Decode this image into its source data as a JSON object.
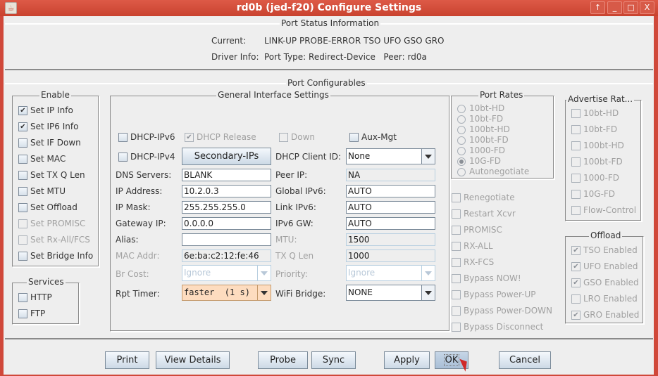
{
  "window": {
    "title": "rd0b  (jed-f20) Configure Settings",
    "buttons": {
      "pin": "↑",
      "minimize": "_",
      "maximize": "□",
      "close": "X"
    }
  },
  "status": {
    "title": "Port Status Information",
    "current_label": "Current:",
    "current_value": "LINK-UP PROBE-ERROR TSO UFO GSO GRO",
    "driver_label": "Driver Info:",
    "driver_value": "Port Type: Redirect-Device   Peer: rd0a"
  },
  "configurables": {
    "title": "Port Configurables",
    "enable": {
      "title": "Enable",
      "items": [
        {
          "label": "Set IP Info",
          "checked": true,
          "disabled": false
        },
        {
          "label": "Set IP6 Info",
          "checked": true,
          "disabled": false
        },
        {
          "label": "Set IF Down",
          "checked": false,
          "disabled": false
        },
        {
          "label": "Set MAC",
          "checked": false,
          "disabled": false
        },
        {
          "label": "Set TX Q Len",
          "checked": false,
          "disabled": false
        },
        {
          "label": "Set MTU",
          "checked": false,
          "disabled": false
        },
        {
          "label": "Set Offload",
          "checked": false,
          "disabled": false
        },
        {
          "label": "Set PROMISC",
          "checked": false,
          "disabled": true
        },
        {
          "label": "Set Rx-All/FCS",
          "checked": false,
          "disabled": true
        },
        {
          "label": "Set Bridge Info",
          "checked": false,
          "disabled": false
        }
      ]
    },
    "services": {
      "title": "Services",
      "items": [
        {
          "label": "HTTP",
          "checked": false
        },
        {
          "label": "FTP",
          "checked": false
        }
      ]
    },
    "general": {
      "title": "General Interface Settings",
      "dhcp_ipv6": {
        "label": "DHCP-IPv6",
        "checked": false
      },
      "dhcp_release": {
        "label": "DHCP Release",
        "checked": true,
        "disabled": true
      },
      "down": {
        "label": "Down",
        "checked": false,
        "disabled": true
      },
      "aux_mgt": {
        "label": "Aux-Mgt",
        "checked": false
      },
      "dhcp_ipv4": {
        "label": "DHCP-IPv4",
        "checked": false
      },
      "secondary_ips": "Secondary-IPs",
      "dhcp_client_id": {
        "label": "DHCP Client ID:",
        "value": "None"
      },
      "dns_servers": {
        "label": "DNS Servers:",
        "value": "BLANK"
      },
      "peer_ip": {
        "label": "Peer IP:",
        "value": "NA"
      },
      "ip_address": {
        "label": "IP Address:",
        "value": "10.2.0.3"
      },
      "global_ipv6": {
        "label": "Global IPv6:",
        "value": "AUTO"
      },
      "ip_mask": {
        "label": "IP Mask:",
        "value": "255.255.255.0"
      },
      "link_ipv6": {
        "label": "Link IPv6:",
        "value": "AUTO"
      },
      "gateway_ip": {
        "label": "Gateway IP:",
        "value": "0.0.0.0"
      },
      "ipv6_gw": {
        "label": "IPv6 GW:",
        "value": "AUTO"
      },
      "alias": {
        "label": "Alias:",
        "value": ""
      },
      "mtu": {
        "label": "MTU:",
        "value": "1500"
      },
      "mac_addr": {
        "label": "MAC Addr:",
        "value": "6e:ba:c2:12:fe:46"
      },
      "tx_q_len": {
        "label": "TX Q Len",
        "value": "1000"
      },
      "br_cost": {
        "label": "Br Cost:",
        "value": "Ignore"
      },
      "priority": {
        "label": "Priority:",
        "value": "Ignore"
      },
      "rpt_timer": {
        "label": "Rpt Timer:",
        "value": "faster  (1 s)"
      },
      "wifi_bridge": {
        "label": "WiFi Bridge:",
        "value": "NONE"
      }
    },
    "port_rates": {
      "title": "Port Rates",
      "options": [
        "10bt-HD",
        "10bt-FD",
        "100bt-HD",
        "100bt-FD",
        "1000-FD",
        "10G-FD",
        "Autonegotiate"
      ],
      "selected": "10G-FD"
    },
    "misc": [
      {
        "label": "Renegotiate",
        "checked": false
      },
      {
        "label": "Restart Xcvr",
        "checked": false
      },
      {
        "label": "PROMISC",
        "checked": false
      },
      {
        "label": "RX-ALL",
        "checked": false
      },
      {
        "label": "RX-FCS",
        "checked": false
      },
      {
        "label": "Bypass NOW!",
        "checked": false
      },
      {
        "label": "Bypass Power-UP",
        "checked": false
      },
      {
        "label": "Bypass Power-DOWN",
        "checked": false
      },
      {
        "label": "Bypass Disconnect",
        "checked": false
      }
    ],
    "advertise": {
      "title": "Advertise Rat...",
      "items": [
        {
          "label": "10bt-HD",
          "checked": false
        },
        {
          "label": "10bt-FD",
          "checked": false
        },
        {
          "label": "100bt-HD",
          "checked": false
        },
        {
          "label": "100bt-FD",
          "checked": false
        },
        {
          "label": "1000-FD",
          "checked": false
        },
        {
          "label": "10G-FD",
          "checked": false
        },
        {
          "label": "Flow-Control",
          "checked": false
        }
      ]
    },
    "offload": {
      "title": "Offload",
      "items": [
        {
          "label": "TSO Enabled",
          "checked": true
        },
        {
          "label": "UFO Enabled",
          "checked": true
        },
        {
          "label": "GSO Enabled",
          "checked": true
        },
        {
          "label": "LRO Enabled",
          "checked": false
        },
        {
          "label": "GRO Enabled",
          "checked": true
        }
      ]
    }
  },
  "footer": {
    "print": "Print",
    "view_details": "View Details",
    "probe": "Probe",
    "sync": "Sync",
    "apply": "Apply",
    "ok": "OK",
    "cancel": "Cancel"
  },
  "check_glyph": "✔"
}
